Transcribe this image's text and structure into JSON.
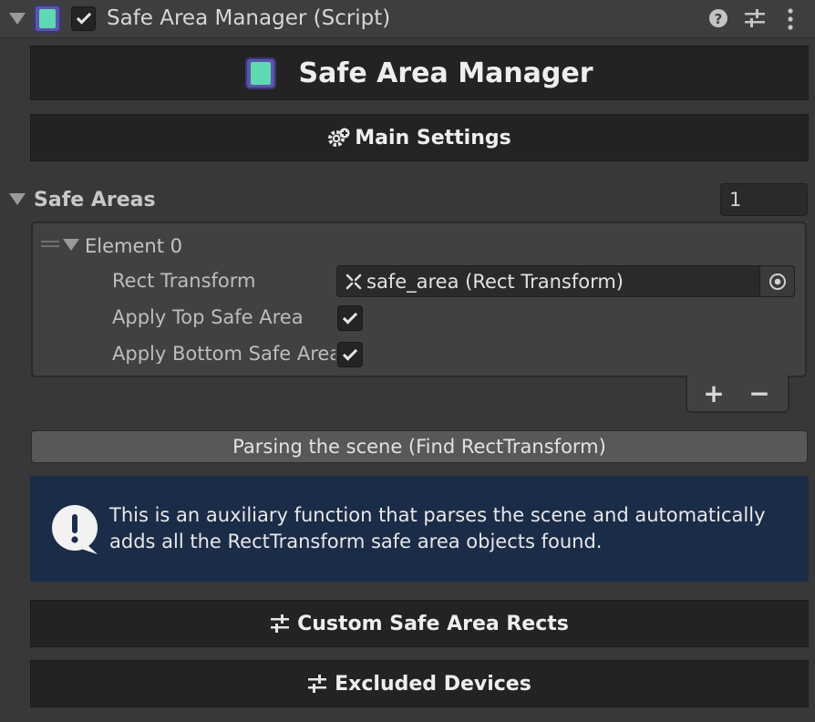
{
  "component": {
    "title": "Safe Area Manager (Script)",
    "enabled": true
  },
  "banner": {
    "title": "Safe Area Manager"
  },
  "sections": {
    "main_settings": "Main Settings",
    "custom_rects": "Custom Safe Area Rects",
    "excluded_devices": "Excluded Devices"
  },
  "safe_areas": {
    "label": "Safe Areas",
    "size": "1",
    "elements": [
      {
        "label": "Element 0",
        "rect_transform_label": "Rect Transform",
        "rect_transform_value": "safe_area (Rect Transform)",
        "apply_top_label": "Apply Top Safe Area",
        "apply_top": true,
        "apply_bottom_label": "Apply Bottom Safe Area",
        "apply_bottom": true
      }
    ],
    "add_label": "+",
    "remove_label": "−"
  },
  "parse_button": "Parsing the scene (Find RectTransform)",
  "help": {
    "text": "This is an auxiliary function that parses the scene and automatically adds all the RectTransform safe area objects found."
  },
  "colors": {
    "background": "#383838",
    "bar": "#232323",
    "help_bg": "#1b2c48",
    "accent_phone": "#5fd9b4"
  },
  "icons": [
    "foldout-arrow-icon",
    "script-phone-icon",
    "help-icon",
    "preset-icon",
    "kebab-menu-icon",
    "gear-plus-icon",
    "drag-handle-icon",
    "rect-transform-icon",
    "object-picker-icon",
    "info-icon",
    "sliders-icon"
  ]
}
